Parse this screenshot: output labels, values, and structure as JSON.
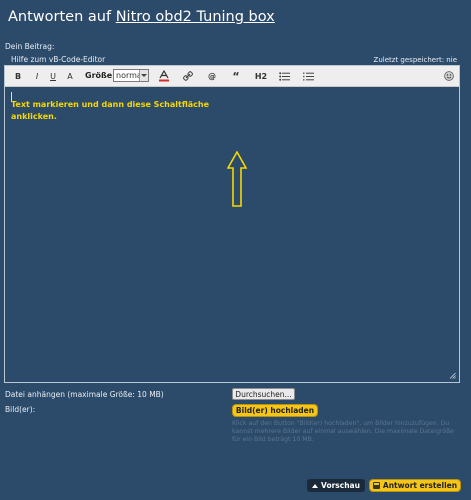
{
  "page": {
    "title_prefix": "Antworten auf",
    "thread_link": "Nitro obd2 Tuning box"
  },
  "editor": {
    "section_label": "Dein Beitrag:",
    "help_link": "Hilfe zum vB-Code-Editor",
    "autosave": "Zuletzt gespeichert: nie",
    "toolbar": {
      "bold": "B",
      "italic": "I",
      "underline": "U",
      "font_letter": "A",
      "size_label": "Größe:",
      "size_value": "normal",
      "heading": "H2"
    },
    "body_text": "Text markieren und dann diese Schaltfläche anklicken.",
    "annotation_color": "#f4d800"
  },
  "attachments": {
    "attach_label": "Datei anhängen (maximale Größe: 10 MB)",
    "browse_button": "Durchsuchen...",
    "images_label": "Bild(er):",
    "upload_button": "Bild(er) hochladen",
    "help_text": "Klick auf den Button \"Bild(er) hochladen\", um Bilder hinzuzufügen. Du kannst mehrere Bilder auf einmal auswählen. Die maximale Dateigröße für ein Bild beträgt 10 MB."
  },
  "actions": {
    "preview": "Vorschau",
    "submit": "Antwort erstellen"
  },
  "colors": {
    "background": "#2c4a6a",
    "accent": "#f5c518",
    "toolbar": "#eeeeee"
  },
  "icons": [
    "font-color-icon",
    "link-icon",
    "mention-icon",
    "quote-icon",
    "bullet-list-icon",
    "numbered-list-icon",
    "smiley-icon",
    "resize-grip-icon",
    "arrow-up-annotation",
    "preview-icon",
    "submit-icon"
  ]
}
